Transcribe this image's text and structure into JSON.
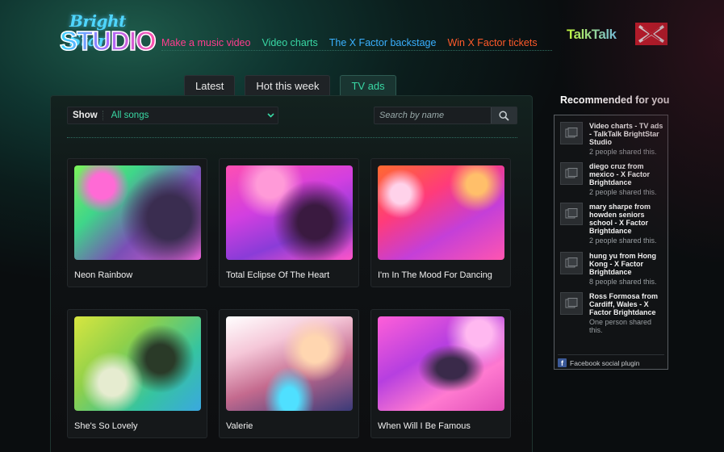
{
  "brand": {
    "logo_top": "Bright Star",
    "logo_bottom": "STUDIO",
    "sponsor": "TalkTalk"
  },
  "nav": [
    {
      "label": "Make a music video",
      "color": "#ff3d8e"
    },
    {
      "label": "Video charts",
      "color": "#39d8a4"
    },
    {
      "label": "The X Factor backstage",
      "color": "#3ab0ff"
    },
    {
      "label": "Win X Factor tickets",
      "color": "#ff5a2a"
    }
  ],
  "tabs": [
    {
      "label": "Latest",
      "active": false
    },
    {
      "label": "Hot this week",
      "active": false
    },
    {
      "label": "TV ads",
      "active": true
    }
  ],
  "filter": {
    "label": "Show",
    "value": "All songs"
  },
  "search": {
    "placeholder": "Search by name"
  },
  "videos": [
    {
      "title": "Neon Rainbow"
    },
    {
      "title": "Total Eclipse Of The Heart"
    },
    {
      "title": "I'm In The Mood For Dancing"
    },
    {
      "title": "She's So Lovely"
    },
    {
      "title": "Valerie"
    },
    {
      "title": "When Will I Be Famous"
    }
  ],
  "recommended": {
    "title": "Recommended for you",
    "items": [
      {
        "name": "Video charts - TV ads - TalkTalk BrightStar Studio",
        "shared": "2 people shared this."
      },
      {
        "name": "diego cruz from mexico - X Factor Brightdance",
        "shared": "2 people shared this."
      },
      {
        "name": "mary sharpe from howden seniors school - X Factor Brightdance",
        "shared": "2 people shared this."
      },
      {
        "name": "hung yu from Hong Kong - X Factor Brightdance",
        "shared": "8 people shared this."
      },
      {
        "name": "Ross Formosa from Cardiff, Wales - X Factor Brightdance",
        "shared": "One person shared this."
      }
    ],
    "footer": "Facebook social plugin"
  },
  "colors": {
    "accent": "#39d8a4",
    "nav_pink": "#ff3d8e",
    "nav_blue": "#3ab0ff",
    "nav_orange": "#ff5a2a"
  }
}
